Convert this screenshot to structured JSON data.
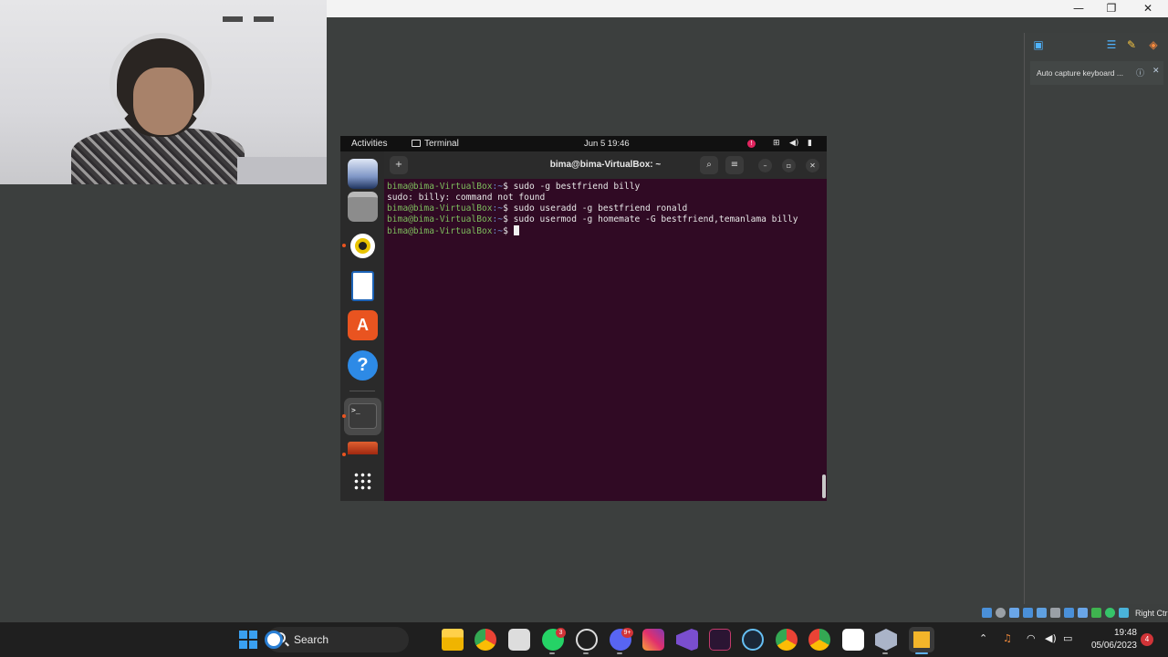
{
  "host_window": {
    "minimize_glyph": "—",
    "maximize_glyph": "❐",
    "close_glyph": "✕"
  },
  "vbox_panel": {
    "notice_text": "Auto capture keyboard ...",
    "notice_info_glyph": "ⓘ",
    "notice_close_glyph": "✕",
    "status_label": "Right Ctrl"
  },
  "ubuntu": {
    "activities": "Activities",
    "app_name": "Terminal",
    "clock": "Jun 5  19:46",
    "alert_glyph": "!"
  },
  "terminal": {
    "title": "bima@bima-VirtualBox: ~",
    "new_tab_glyph": "+",
    "search_glyph": "⌕",
    "menu_glyph": "≡",
    "minimize_glyph": "–",
    "restore_glyph": "▫",
    "close_glyph": "✕",
    "prompt_user": "bima@bima-VirtualBox",
    "prompt_path": ":~",
    "prompt_symbol": "$ ",
    "lines": [
      {
        "command": "sudo -g bestfriend billy"
      },
      {
        "output": "sudo: billy: command not found"
      },
      {
        "command": "sudo useradd -g bestfriend ronald"
      },
      {
        "command": "sudo usermod -g homemate -G bestfriend,temanlama billy"
      },
      {
        "command": ""
      }
    ]
  },
  "taskbar": {
    "search_label": "Search",
    "time": "19:48",
    "date": "05/06/2023",
    "notification_count": "4",
    "whatsapp_badge": "3",
    "discord_badge": "9+"
  },
  "colors": {
    "terminal_bg": "#300a24",
    "prompt_user": "#7dbd5d",
    "prompt_path": "#6f8ed6",
    "ubuntu_orange": "#e95420"
  }
}
